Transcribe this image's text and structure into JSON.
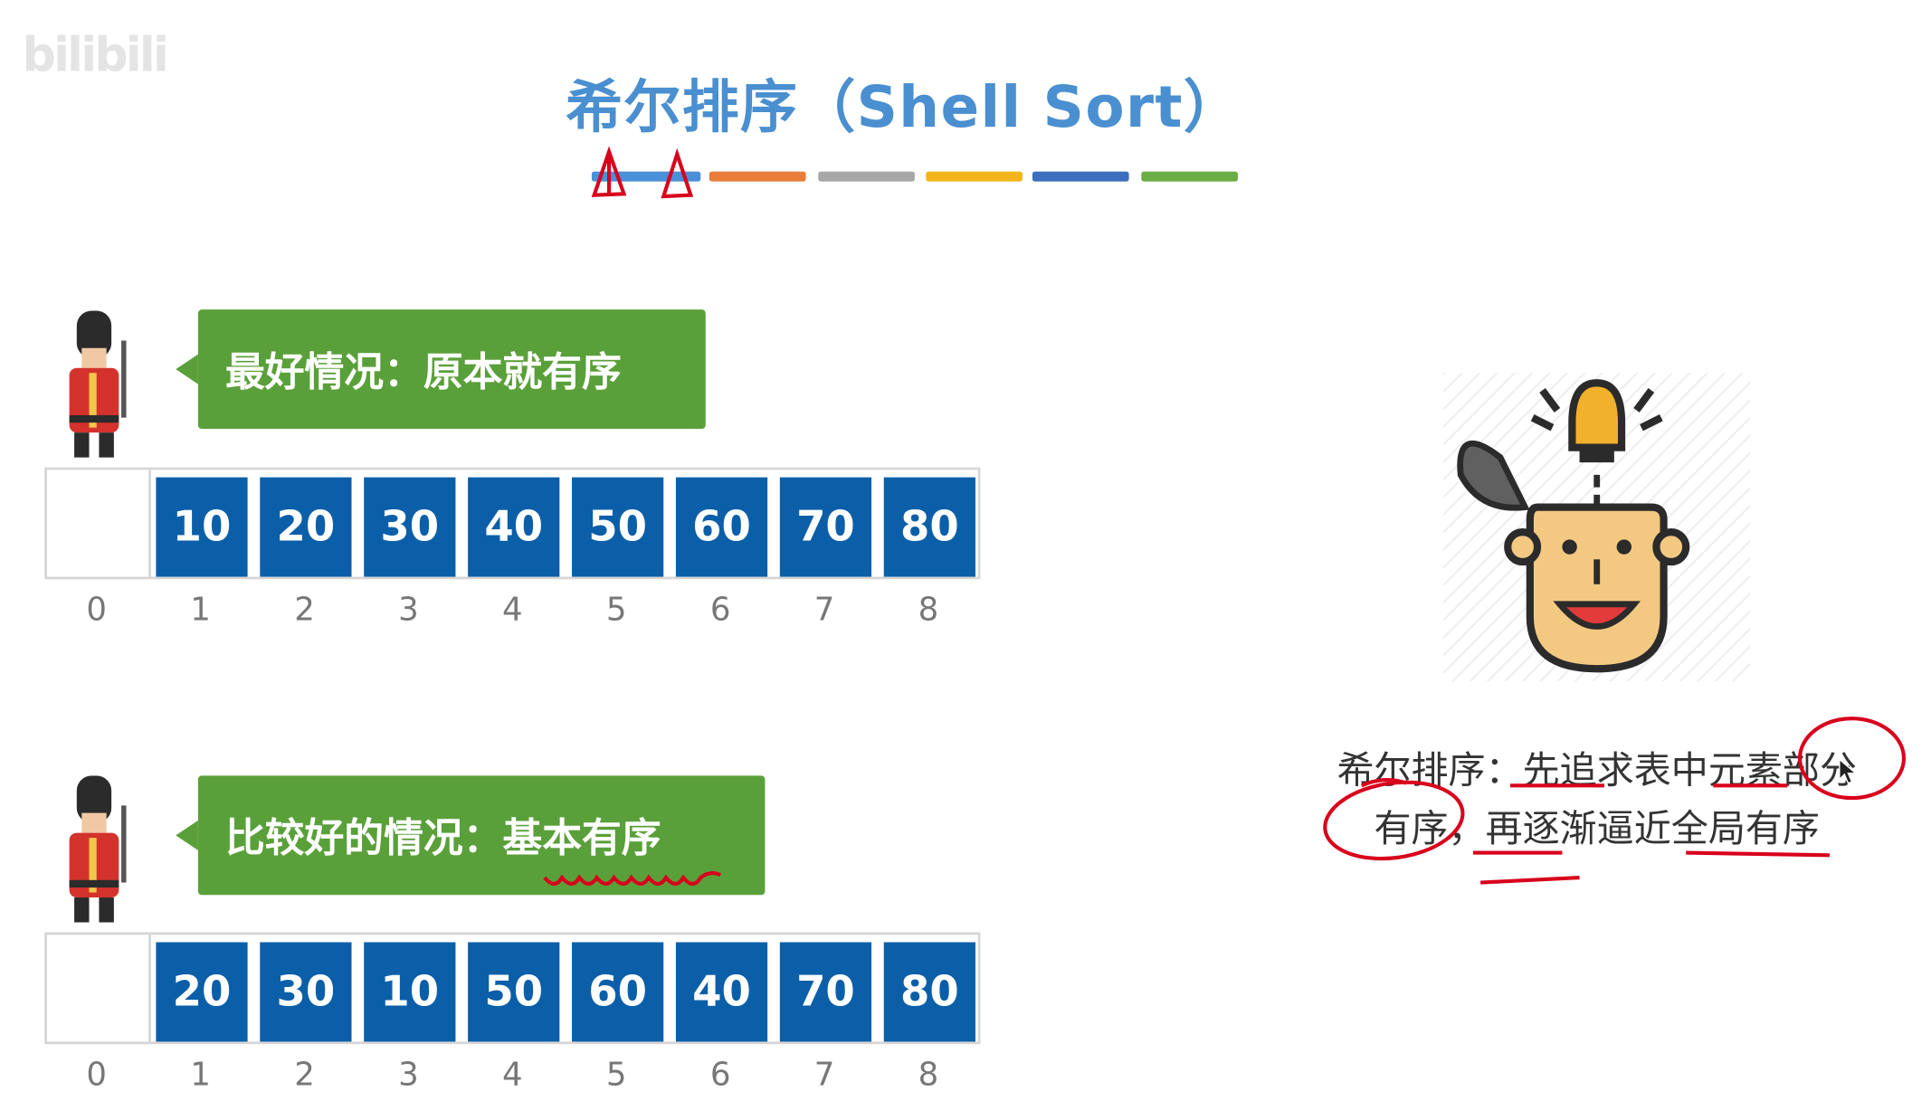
{
  "watermark": "bilibili",
  "title": "希尔排序（Shell Sort）",
  "color_bar": [
    "#4a90d9",
    "#e87d3a",
    "#a8a8a8",
    "#f2b61c",
    "#3d6fbf",
    "#6aae45"
  ],
  "best_case": {
    "label": "最好情况：原本就有序",
    "cells": [
      "",
      "10",
      "20",
      "30",
      "40",
      "50",
      "60",
      "70",
      "80"
    ],
    "indices": [
      "0",
      "1",
      "2",
      "3",
      "4",
      "5",
      "6",
      "7",
      "8"
    ]
  },
  "good_case": {
    "label_prefix": "比较好的情况：",
    "label_emphasis": "基本有序",
    "cells": [
      "",
      "20",
      "30",
      "10",
      "50",
      "60",
      "40",
      "70",
      "80"
    ],
    "indices": [
      "0",
      "1",
      "2",
      "3",
      "4",
      "5",
      "6",
      "7",
      "8"
    ]
  },
  "idea": {
    "line1": "希尔排序：先追求表中元素部分",
    "line2": "有序，再逐渐逼近全局有序"
  },
  "icons": [
    "guard-icon",
    "lightbulb-head-icon",
    "mouse-cursor-icon"
  ],
  "colors": {
    "cell_blue": "#0b5fa9",
    "bubble_green": "#5aa03a",
    "title_blue": "#4a8fd0",
    "ink_red": "#d8001c"
  }
}
